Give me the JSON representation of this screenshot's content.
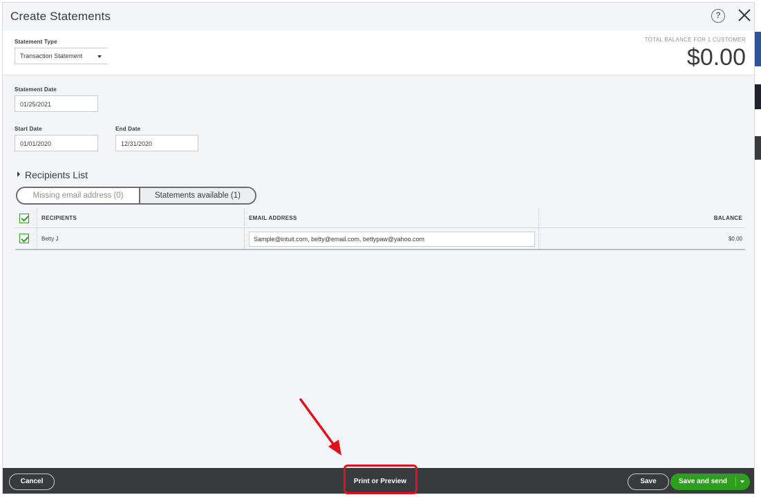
{
  "dialog": {
    "title": "Create Statements",
    "help_glyph": "?",
    "icons": {
      "help": "help-circle-icon",
      "close": "close-x-icon"
    }
  },
  "statement_type": {
    "label": "Statement Type",
    "value": "Transaction Statement"
  },
  "total": {
    "label": "TOTAL BALANCE FOR 1 CUSTOMER",
    "value": "$0.00"
  },
  "dates": {
    "statement_date_label": "Statement Date",
    "statement_date": "01/25/2021",
    "start_date_label": "Start Date",
    "start_date": "01/01/2020",
    "end_date_label": "End Date",
    "end_date": "12/31/2020"
  },
  "recipients": {
    "toggle_label": "Recipients List",
    "tabs": [
      {
        "label": "Missing email address (0)",
        "selected": false
      },
      {
        "label": "Statements available (1)",
        "selected": true
      }
    ],
    "columns": [
      "RECIPIENTS",
      "EMAIL ADDRESS",
      "BALANCE"
    ],
    "rows": [
      {
        "name": "Betty J",
        "email": "Sample@intuit.com, betty@email.com, bettypaw@yahoo.com",
        "balance": "$0.00",
        "checked": true
      }
    ]
  },
  "footer": {
    "cancel": "Cancel",
    "print": "Print or Preview",
    "save": "Save",
    "save_send": "Save and send"
  },
  "colors": {
    "accent_green": "#2ca01c",
    "footer_bg": "#393a3d",
    "annotation_red": "#e3101a"
  }
}
